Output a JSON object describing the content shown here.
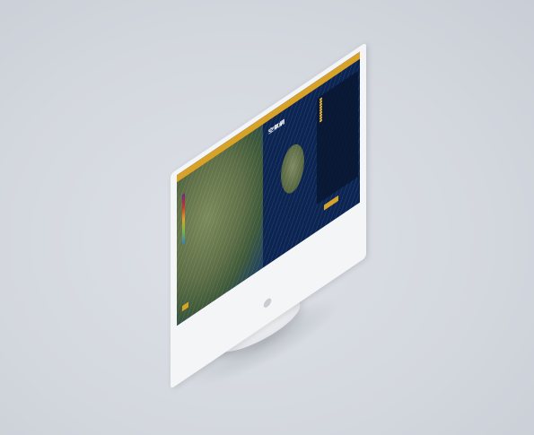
{
  "app": {
    "brand": "空氣網"
  },
  "panel": {
    "rows": [
      "",
      "",
      "",
      "",
      "",
      "",
      "",
      "",
      ""
    ]
  },
  "buttons": {
    "primary": ""
  },
  "colors": {
    "accent": "#d8a228",
    "ocean": "#0b2452",
    "background": "#d3d7de"
  },
  "icons": [
    "logo-icon",
    "apple-logo-icon"
  ]
}
